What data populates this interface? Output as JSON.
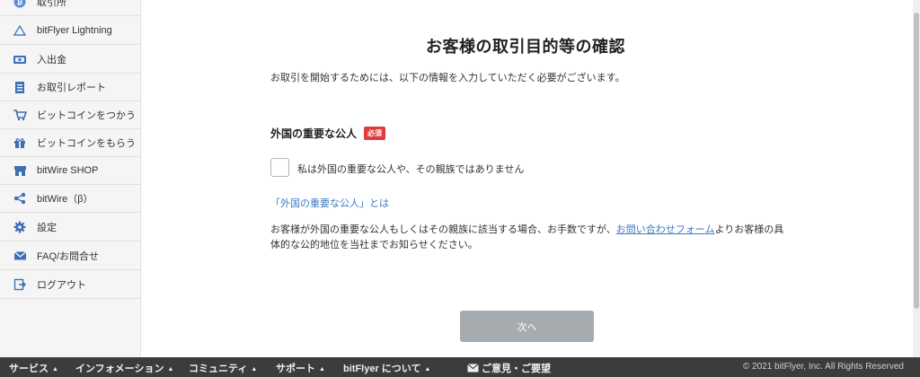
{
  "sidebar": {
    "items": [
      {
        "label": "取引所",
        "icon": "bitcoin-icon"
      },
      {
        "label": "bitFlyer Lightning",
        "icon": "lightning-icon"
      },
      {
        "label": "入出金",
        "icon": "deposit-icon"
      },
      {
        "label": "お取引レポート",
        "icon": "report-icon"
      },
      {
        "label": "ビットコインをつかう",
        "icon": "cart-icon"
      },
      {
        "label": "ビットコインをもらう",
        "icon": "gift-icon"
      },
      {
        "label": "bitWire SHOP",
        "icon": "shop-icon"
      },
      {
        "label": "bitWire（β）",
        "icon": "share-icon"
      },
      {
        "label": "設定",
        "icon": "gear-icon"
      },
      {
        "label": "FAQ/お問合せ",
        "icon": "mail-icon"
      },
      {
        "label": "ログアウト",
        "icon": "logout-icon"
      }
    ]
  },
  "main": {
    "title": "お客様の取引目的等の確認",
    "intro": "お取引を開始するためには、以下の情報を入力していただく必要がございます。",
    "section_title": "外国の重要な公人",
    "required_badge": "必須",
    "checkbox_label": "私は外国の重要な公人や、その親族ではありません",
    "info_link": "「外国の重要な公人」とは",
    "notice_before": "お客様が外国の重要な公人もしくはその親族に該当する場合、お手数ですが、",
    "notice_link": "お問い合わせフォーム",
    "notice_after": "よりお客様の具体的な公的地位を当社までお知らせください。",
    "next_button": "次へ"
  },
  "footer": {
    "menu": [
      "サービス",
      "インフォメーション",
      "コミュニティ",
      "サポート",
      "bitFlyer について"
    ],
    "feedback": "ご意見・ご要望",
    "copyright": "© 2021 bitFlyer, Inc. All Rights Reserved"
  },
  "colors": {
    "accent_blue": "#3d7bc0",
    "required_red": "#e03c3c",
    "button_disabled": "#a6abb0",
    "footer_bg": "#3c3c3c"
  }
}
